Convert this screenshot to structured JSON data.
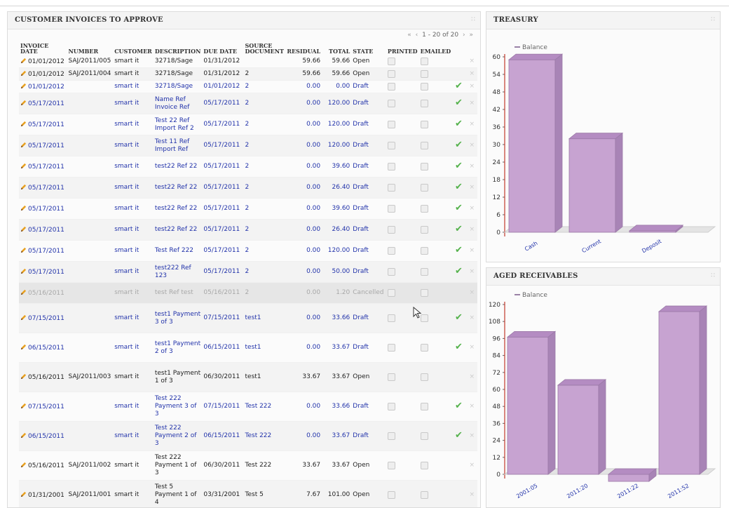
{
  "invoices_panel": {
    "title": "CUSTOMER INVOICES TO APPROVE",
    "pager": {
      "first": "«",
      "prev": "‹",
      "range": "1 - 20 of 20",
      "next": "›",
      "last": "»"
    },
    "columns": [
      "INVOICE DATE",
      "NUMBER",
      "CUSTOMER",
      "DESCRIPTION",
      "DUE DATE",
      "SOURCE DOCUMENT",
      "RESIDUAL",
      "TOTAL",
      "STATE",
      "PRINTED",
      "EMAILED"
    ],
    "rows": [
      {
        "date": "01/01/2012",
        "number": "SAJ/2011/005",
        "customer": "smart it",
        "description": "32718/Sage",
        "due": "01/31/2012",
        "source": "",
        "residual": "59.66",
        "total": "59.66",
        "state": "Open",
        "kind": "open",
        "approve": false
      },
      {
        "date": "01/01/2012",
        "number": "SAJ/2011/004",
        "customer": "smart it",
        "description": "32718/Sage",
        "due": "01/31/2012",
        "source": "2",
        "residual": "59.66",
        "total": "59.66",
        "state": "Open",
        "kind": "open",
        "approve": false
      },
      {
        "date": "01/01/2012",
        "number": "",
        "customer": "smart it",
        "description": "32718/Sage",
        "due": "01/01/2012",
        "source": "2",
        "residual": "0.00",
        "total": "0.00",
        "state": "Draft",
        "kind": "draft",
        "approve": true
      },
      {
        "date": "05/17/2011",
        "number": "",
        "customer": "smart it",
        "description": "Name Ref Invoice Ref",
        "due": "05/17/2011",
        "source": "2",
        "residual": "0.00",
        "total": "120.00",
        "state": "Draft",
        "kind": "draft",
        "approve": true
      },
      {
        "date": "05/17/2011",
        "number": "",
        "customer": "smart it",
        "description": "Test 22 Ref Import Ref 2",
        "due": "05/17/2011",
        "source": "2",
        "residual": "0.00",
        "total": "120.00",
        "state": "Draft",
        "kind": "draft",
        "approve": true
      },
      {
        "date": "05/17/2011",
        "number": "",
        "customer": "smart it",
        "description": "Test 11 Ref Import Ref",
        "due": "05/17/2011",
        "source": "2",
        "residual": "0.00",
        "total": "120.00",
        "state": "Draft",
        "kind": "draft",
        "approve": true
      },
      {
        "date": "05/17/2011",
        "number": "",
        "customer": "smart it",
        "description": "test22 Ref 22",
        "due": "05/17/2011",
        "source": "2",
        "residual": "0.00",
        "total": "39.60",
        "state": "Draft",
        "kind": "draft",
        "approve": true
      },
      {
        "date": "05/17/2011",
        "number": "",
        "customer": "smart it",
        "description": "test22 Ref 22",
        "due": "05/17/2011",
        "source": "2",
        "residual": "0.00",
        "total": "26.40",
        "state": "Draft",
        "kind": "draft",
        "approve": true
      },
      {
        "date": "05/17/2011",
        "number": "",
        "customer": "smart it",
        "description": "test22 Ref 22",
        "due": "05/17/2011",
        "source": "2",
        "residual": "0.00",
        "total": "39.60",
        "state": "Draft",
        "kind": "draft",
        "approve": true
      },
      {
        "date": "05/17/2011",
        "number": "",
        "customer": "smart it",
        "description": "test22 Ref 22",
        "due": "05/17/2011",
        "source": "2",
        "residual": "0.00",
        "total": "26.40",
        "state": "Draft",
        "kind": "draft",
        "approve": true
      },
      {
        "date": "05/17/2011",
        "number": "",
        "customer": "smart it",
        "description": "Test Ref 222",
        "due": "05/17/2011",
        "source": "2",
        "residual": "0.00",
        "total": "120.00",
        "state": "Draft",
        "kind": "draft",
        "approve": true
      },
      {
        "date": "05/17/2011",
        "number": "",
        "customer": "smart it",
        "description": "test222 Ref 123",
        "due": "05/17/2011",
        "source": "2",
        "residual": "0.00",
        "total": "50.00",
        "state": "Draft",
        "kind": "draft",
        "approve": true
      },
      {
        "date": "05/16/2011",
        "number": "",
        "customer": "smart it",
        "description": "test Ref test",
        "due": "05/16/2011",
        "source": "2",
        "residual": "0.00",
        "total": "1.20",
        "state": "Cancelled",
        "kind": "cancel",
        "approve": false
      },
      {
        "date": "07/15/2011",
        "number": "",
        "customer": "smart it",
        "description": "test1 Payment 3 of 3",
        "due": "07/15/2011",
        "source": "test1",
        "residual": "0.00",
        "total": "33.66",
        "state": "Draft",
        "kind": "draft",
        "approve": true
      },
      {
        "date": "06/15/2011",
        "number": "",
        "customer": "smart it",
        "description": "test1 Payment 2 of 3",
        "due": "06/15/2011",
        "source": "test1",
        "residual": "0.00",
        "total": "33.67",
        "state": "Draft",
        "kind": "draft",
        "approve": true
      },
      {
        "date": "05/16/2011",
        "number": "SAJ/2011/003",
        "customer": "smart it",
        "description": "test1 Payment 1 of 3",
        "due": "06/30/2011",
        "source": "test1",
        "residual": "33.67",
        "total": "33.67",
        "state": "Open",
        "kind": "open",
        "approve": false
      },
      {
        "date": "07/15/2011",
        "number": "",
        "customer": "smart it",
        "description": "Test 222 Payment 3 of 3",
        "due": "07/15/2011",
        "source": "Test 222",
        "residual": "0.00",
        "total": "33.66",
        "state": "Draft",
        "kind": "draft",
        "approve": true
      },
      {
        "date": "06/15/2011",
        "number": "",
        "customer": "smart it",
        "description": "Test 222 Payment 2 of 3",
        "due": "06/15/2011",
        "source": "Test 222",
        "residual": "0.00",
        "total": "33.67",
        "state": "Draft",
        "kind": "draft",
        "approve": true
      },
      {
        "date": "05/16/2011",
        "number": "SAJ/2011/002",
        "customer": "smart it",
        "description": "Test 222 Payment 1 of 3",
        "due": "06/30/2011",
        "source": "Test 222",
        "residual": "33.67",
        "total": "33.67",
        "state": "Open",
        "kind": "open",
        "approve": false
      },
      {
        "date": "01/31/2001",
        "number": "SAJ/2011/001",
        "customer": "smart it",
        "description": "Test 5 Payment 1 of 4",
        "due": "03/31/2001",
        "source": "Test 5",
        "residual": "7.67",
        "total": "101.00",
        "state": "Open",
        "kind": "open",
        "approve": false
      }
    ]
  },
  "treasury_panel": {
    "title": "TREASURY"
  },
  "aged_panel": {
    "title": "AGED RECEIVABLES"
  },
  "chart_data": [
    {
      "type": "bar",
      "title": "TREASURY",
      "categories": [
        "Cash",
        "Current",
        "Deposit"
      ],
      "series": [
        {
          "name": "Balance",
          "values": [
            59,
            32,
            0.5
          ]
        }
      ],
      "yticks": [
        0,
        6,
        12,
        18,
        24,
        30,
        36,
        42,
        48,
        54,
        60
      ],
      "ylim": [
        0,
        60
      ],
      "legend": "top-left",
      "color": "#c7a3d1"
    },
    {
      "type": "bar",
      "title": "AGED RECEIVABLES",
      "categories": [
        "2001:05",
        "2011:20",
        "2011:22",
        "2011:52"
      ],
      "series": [
        {
          "name": "Balance",
          "values": [
            97,
            63,
            -5,
            115
          ]
        }
      ],
      "yticks": [
        0,
        12,
        24,
        36,
        48,
        60,
        72,
        84,
        96,
        108,
        120
      ],
      "ylim": [
        0,
        120
      ],
      "legend": "top-left",
      "color": "#c7a3d1"
    }
  ],
  "colors": {
    "bar": "#c7a3d1",
    "bar_top": "#b48cc2",
    "draft_text": "#2233aa",
    "approve": "#55b24c"
  }
}
